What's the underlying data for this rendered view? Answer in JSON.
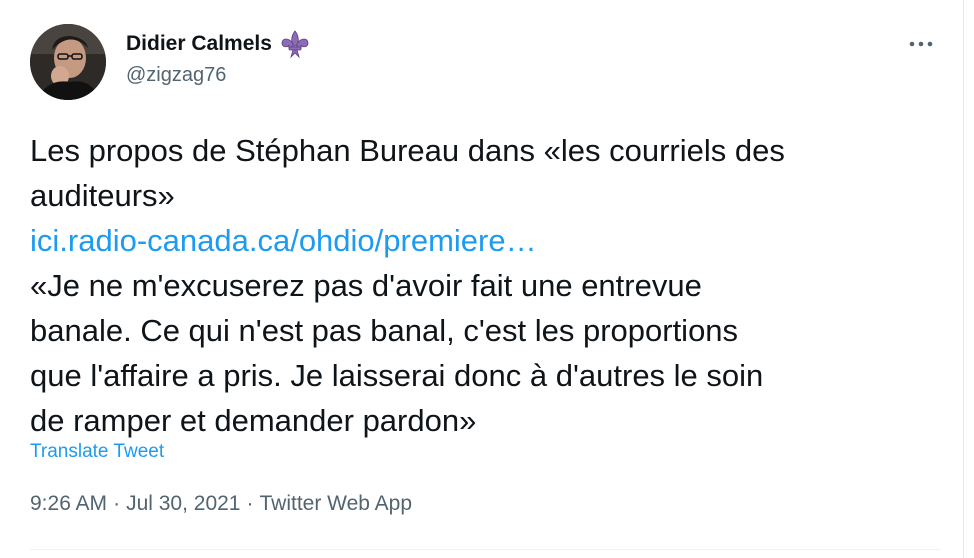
{
  "author": {
    "name": "Didier Calmels",
    "handle": "@zigzag76",
    "badge_icon": "fleur-de-lis-icon",
    "badge_color": "#8e6bb8"
  },
  "more_icon": "more-horizontal-icon",
  "tweet": {
    "text_line_1": "Les propos de Stéphan Bureau dans «les courriels des",
    "text_line_2": "auditeurs»",
    "link": "ici.radio-canada.ca/ohdio/premiere…",
    "quote_line_1": "«Je ne m'excuserez pas d'avoir fait une entrevue",
    "quote_line_2": "banale. Ce qui n'est pas banal, c'est les proportions",
    "quote_line_3": "que l'affaire a pris. Je laisserai donc à d'autres le soin",
    "quote_line_4": "de ramper et demander pardon»"
  },
  "translate_label": "Translate Tweet",
  "meta": {
    "time": "9:26 AM",
    "separator": "·",
    "date": "Jul 30, 2021",
    "source": "Twitter Web App"
  },
  "colors": {
    "link": "#1d9bf0",
    "secondary_text": "#536471",
    "primary_text": "#0f1419"
  }
}
